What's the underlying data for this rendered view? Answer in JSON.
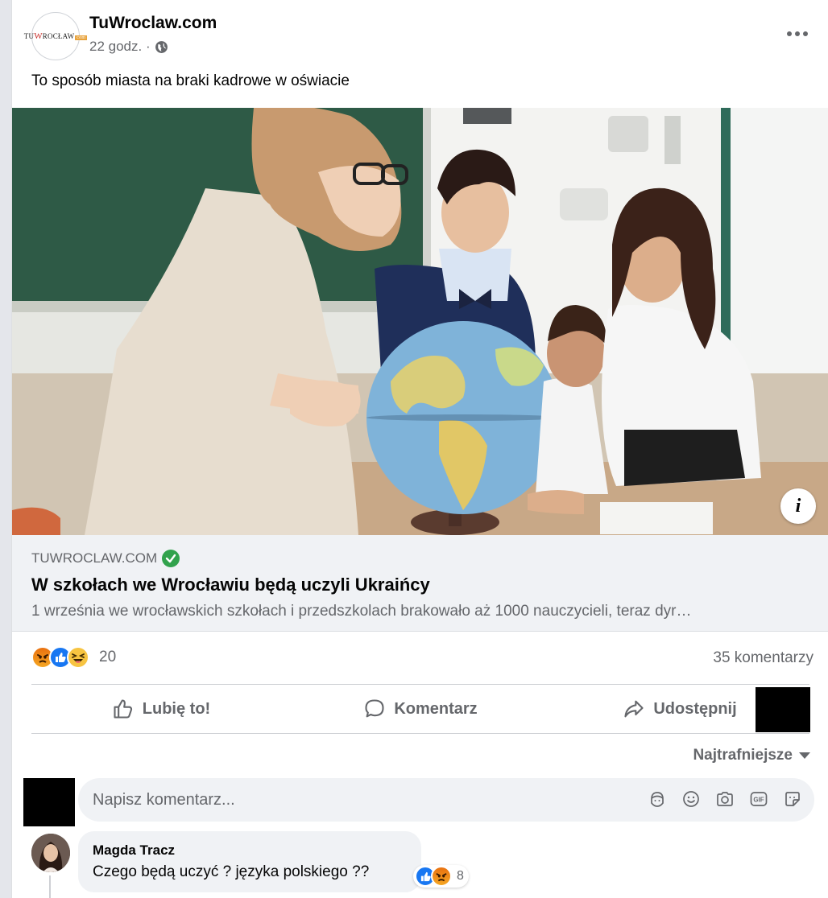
{
  "post": {
    "page_name": "TuWroclaw.com",
    "time": "22 godz. ·",
    "caption": "To sposób miasta na braki kadrowe w oświacie",
    "logo": {
      "left": "TU",
      "w": "W",
      "mid": "ROCŁAW",
      "tag": "com"
    }
  },
  "link": {
    "domain": "TUWROCLAW.COM",
    "title": "W szkołach we Wrocławiu będą uczyli Ukraińcy",
    "description": "1 września we wrocławskich szkołach i przedszkolach brakowało aż 1000 nauczycieli, teraz dyr…",
    "info_icon": "i"
  },
  "stats": {
    "reaction_count": "20",
    "comments": "35 komentarzy",
    "reaction_icons": [
      "angry-icon",
      "like-icon",
      "haha-icon"
    ]
  },
  "actions": {
    "like": "Lubię to!",
    "comment": "Komentarz",
    "share": "Udostępnij"
  },
  "sort": {
    "label": "Najtrafniejsze"
  },
  "composer": {
    "placeholder": "Napisz komentarz..."
  },
  "comments": [
    {
      "author": "Magda Tracz",
      "text": "Czego będą uczyć ? języka polskiego ??",
      "reaction_count": "8"
    }
  ],
  "colors": {
    "like_blue": "#1877f2",
    "secondary_text": "#65676b",
    "verified_green": "#31a24c",
    "chalkboard_green": "#2e5a46"
  }
}
